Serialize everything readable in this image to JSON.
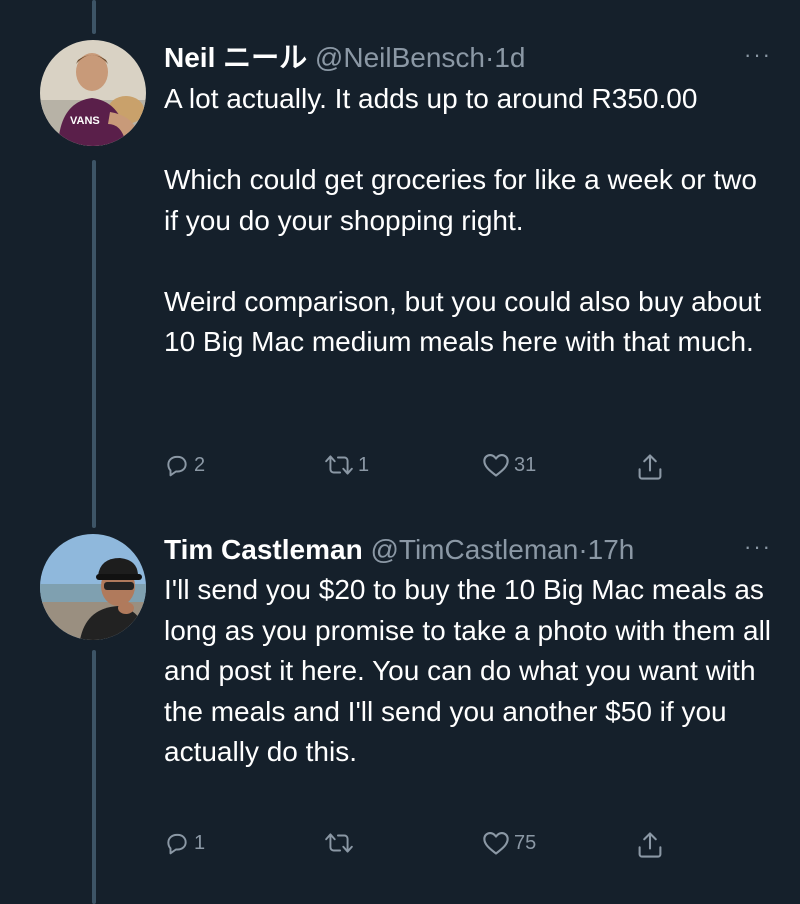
{
  "tweets": [
    {
      "name": "Neil ニール",
      "handle": "@NeilBensch",
      "separator": "·",
      "time": "1d",
      "more": "···",
      "paragraphs": [
        "A lot actually. It adds up to around R350.00",
        "Which could get groceries for like a week or two if you do your shopping right.",
        "Weird comparison, but you could also buy about 10 Big Mac medium meals here with that much."
      ],
      "replies": "2",
      "retweets": "1",
      "likes": "31",
      "avatar_shirt_text": "VANS"
    },
    {
      "name": "Tim Castleman",
      "handle": "@TimCastleman",
      "separator": "·",
      "time": "17h",
      "more": "···",
      "paragraphs": [
        "I'll send you $20 to buy the 10 Big Mac meals as long as you promise to take a photo with them all and post it here. You can do what you want with the meals and I'll send you another $50 if you actually do this."
      ],
      "replies": "1",
      "retweets": "",
      "likes": "75"
    }
  ],
  "colors": {
    "background": "#15202b",
    "text": "#ffffff",
    "secondary": "#8b98a5",
    "thread_line": "#3d5466"
  },
  "icons": [
    "reply-icon",
    "retweet-icon",
    "like-icon",
    "share-icon",
    "more-icon"
  ]
}
